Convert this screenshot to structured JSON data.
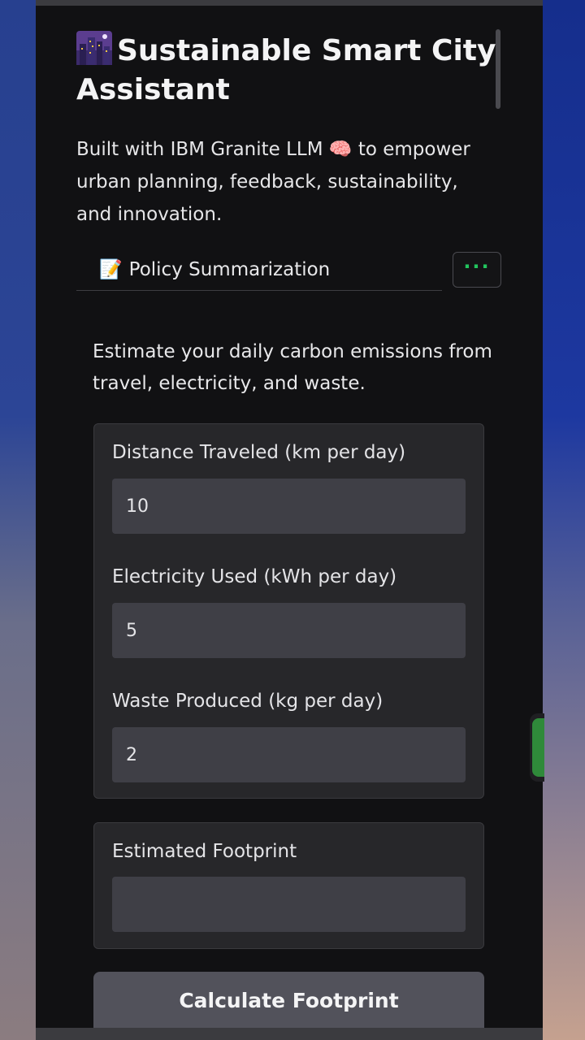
{
  "app": {
    "title": "Sustainable Smart City Assistant",
    "title_icon": "city-night-icon",
    "subtitle": "Built with IBM Granite LLM 🧠 to empower urban planning, feedback, sustainability, and innovation."
  },
  "tabs": {
    "active_icon": "📝",
    "active_label": "Policy Summarization",
    "more_icon": "more-dots-icon"
  },
  "calculator": {
    "description": "Estimate your daily carbon emissions from travel, electricity, and waste.",
    "fields": [
      {
        "label": "Distance Traveled (km per day)",
        "value": "10"
      },
      {
        "label": "Electricity Used (kWh per day)",
        "value": "5"
      },
      {
        "label": "Waste Produced (kg per day)",
        "value": "2"
      }
    ],
    "output_label": "Estimated Footprint",
    "output_value": "",
    "button_label": "Calculate Footprint"
  },
  "colors": {
    "panel_bg": "#111113",
    "box_bg": "#27272a",
    "input_bg": "#3f3f46",
    "button_bg": "#52525b",
    "accent_green": "#22c55e"
  }
}
